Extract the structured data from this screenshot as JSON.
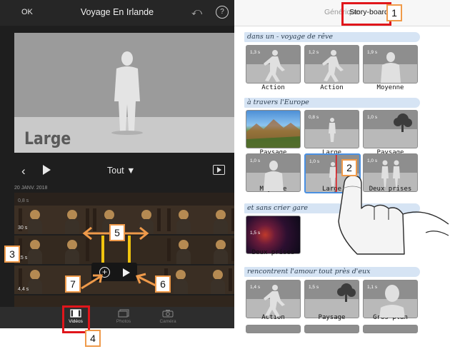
{
  "left": {
    "ok_label": "OK",
    "project_title": "Voyage En Irlande",
    "preview_caption": "Large",
    "filter_label": "Tout ▼",
    "date": "20 JANV. 2018",
    "clip_durations": [
      "0,8 s",
      "30 s",
      "15 s",
      "4,4 s"
    ],
    "tabs": [
      {
        "label": "Vidéos",
        "icon": "film-icon"
      },
      {
        "label": "Photos",
        "icon": "photos-icon"
      },
      {
        "label": "Caméra",
        "icon": "camera-icon"
      }
    ]
  },
  "right": {
    "segments": [
      "Générique",
      "Story-board"
    ],
    "sections": [
      {
        "title": "dans un - voyage de rêve",
        "tiles": [
          {
            "duration": "1,3 s",
            "caption": "Action"
          },
          {
            "duration": "1,2 s",
            "caption": "Action"
          },
          {
            "duration": "1,9 s",
            "caption": "Moyenne"
          }
        ]
      },
      {
        "title": "à travers l'Europe",
        "tiles": [
          {
            "duration": "",
            "caption": "Paysage"
          },
          {
            "duration": "0,8 s",
            "caption": "Large"
          },
          {
            "duration": "1,0 s",
            "caption": "Paysage"
          },
          {
            "duration": "1,0 s",
            "caption": "Moyenne"
          },
          {
            "duration": "1,0 s",
            "caption": "Large"
          },
          {
            "duration": "1,0 s",
            "caption": "Deux prises"
          }
        ]
      },
      {
        "title": "et sans crier gare",
        "tiles": [
          {
            "duration": "1,5 s",
            "caption": "Deux prises"
          }
        ]
      },
      {
        "title": "rencontrent l'amour tout près d'eux",
        "tiles": [
          {
            "duration": "1,4 s",
            "caption": "Action"
          },
          {
            "duration": "1,5 s",
            "caption": "Paysage"
          },
          {
            "duration": "1,1 s",
            "caption": "Gros plan"
          }
        ]
      }
    ]
  },
  "annotations": [
    "1",
    "2",
    "3",
    "4",
    "5",
    "6",
    "7"
  ],
  "colors": {
    "highlight_red": "#e0161b",
    "annotation_orange": "#ef9a4a",
    "selection_yellow": "#f1c40f",
    "section_blue": "#d6e4f4",
    "selected_tile_blue": "#4a90e2"
  }
}
